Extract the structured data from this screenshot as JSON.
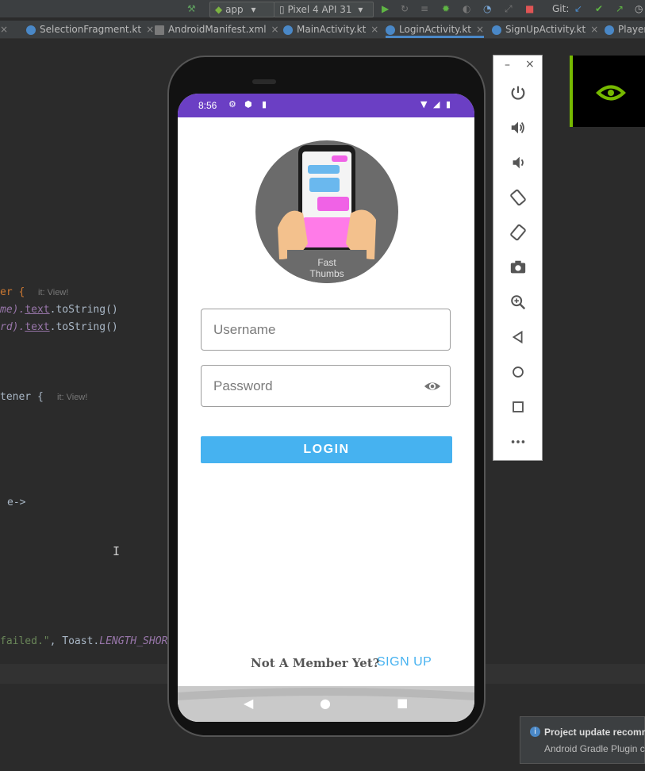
{
  "toolbar": {
    "run_config": "app",
    "device": "Pixel 4 API 31",
    "git_label": "Git:"
  },
  "tabs": [
    {
      "label": "SelectionFragment.kt"
    },
    {
      "label": "AndroidManifest.xml"
    },
    {
      "label": "MainActivity.kt"
    },
    {
      "label": "LoginActivity.kt"
    },
    {
      "label": "SignUpActivity.kt"
    },
    {
      "label": "Player.k"
    }
  ],
  "code": {
    "line1": "er {",
    "line1_hint": "it: View!",
    "line2_pre": "me).",
    "line2_prop": "text",
    "line2_post": ".toString()",
    "line3_pre": "rd).",
    "line3_prop": "text",
    "line3_post": ".toString()",
    "line4": "tener {",
    "line4_hint": "it: View!",
    "line5": "e->",
    "line6_str": "failed.\"",
    "line6_mid": ", Toast.",
    "line6_const": "LENGTH_SHOR"
  },
  "phone": {
    "status_time": "8:56",
    "logo_text_1": "Fast",
    "logo_text_2": "Thumbs",
    "username_placeholder": "Username",
    "password_placeholder": "Password",
    "login_label": "LOGIN",
    "not_member_text": "Not A Member Yet?",
    "signup_label": "SIGN UP"
  },
  "notification": {
    "title": "Project update recomm",
    "body": "Android Gradle Plugin c"
  },
  "colors": {
    "status_bar": "#6b3fc4",
    "accent": "#46b2f0",
    "ide_bg": "#2b2b2b"
  }
}
